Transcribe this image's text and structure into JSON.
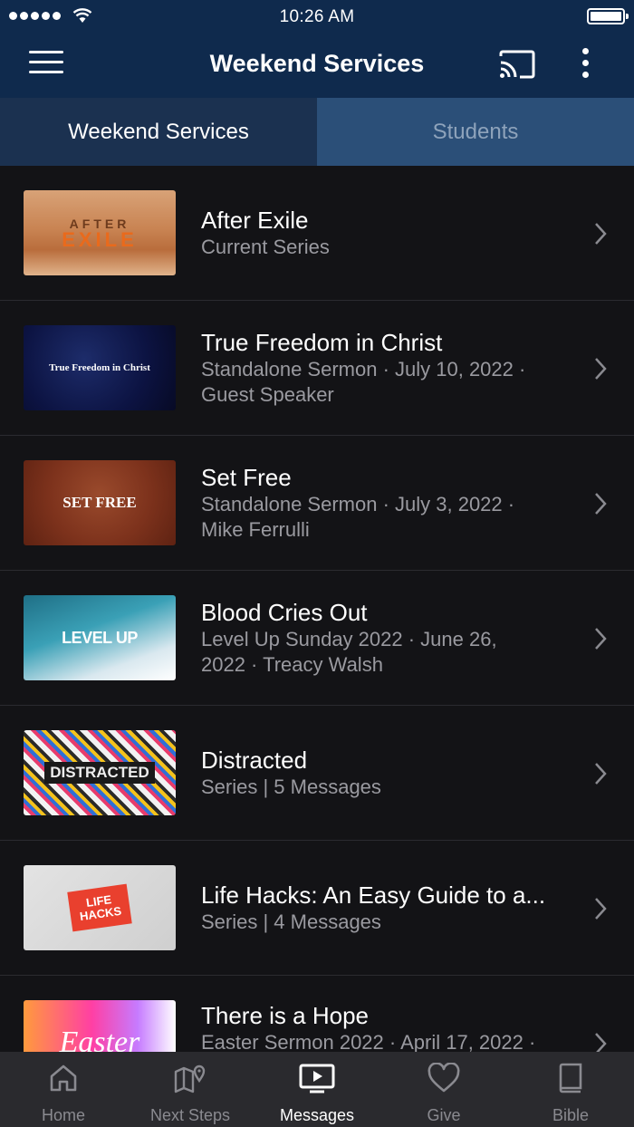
{
  "status_bar": {
    "time": "10:26 AM"
  },
  "header": {
    "title": "Weekend Services"
  },
  "tabs": [
    {
      "label": "Weekend Services",
      "active": true
    },
    {
      "label": "Students",
      "active": false
    }
  ],
  "items": [
    {
      "title": "After Exile",
      "line1": "Current Series",
      "line2": "",
      "thumb_text": [
        "AFTER",
        "EXILE"
      ]
    },
    {
      "title": "True Freedom in Christ",
      "line1": "Standalone Sermon · July 10, 2022 ·",
      "line2": "Guest Speaker",
      "thumb_text": "True Freedom in Christ"
    },
    {
      "title": "Set Free",
      "line1": "Standalone Sermon · July 3, 2022 ·",
      "line2": "Mike Ferrulli",
      "thumb_text": "SET FREE"
    },
    {
      "title": "Blood Cries Out",
      "line1": "Level Up Sunday 2022 · June 26,",
      "line2": "2022 · Treacy Walsh",
      "thumb_text": "LEVEL UP"
    },
    {
      "title": "Distracted",
      "line1": "Series | 5 Messages",
      "line2": "",
      "thumb_text": "DISTRACTED"
    },
    {
      "title": "Life Hacks: An Easy Guide to a...",
      "line1": "Series | 4 Messages",
      "line2": "",
      "thumb_text": [
        "LIFE",
        "HACKS"
      ]
    },
    {
      "title": "There is a Hope",
      "line1": "Easter Sermon 2022 · April 17, 2022 ·",
      "line2": "",
      "thumb_text": "Easter"
    }
  ],
  "bottom_nav": [
    {
      "label": "Home",
      "icon": "home-icon",
      "active": false
    },
    {
      "label": "Next Steps",
      "icon": "map-pin-icon",
      "active": false
    },
    {
      "label": "Messages",
      "icon": "tv-play-icon",
      "active": true
    },
    {
      "label": "Give",
      "icon": "heart-icon",
      "active": false
    },
    {
      "label": "Bible",
      "icon": "book-icon",
      "active": false
    }
  ],
  "colors": {
    "header_bg": "#0f2a4d",
    "tab_active_bg": "#1b3150",
    "tab_inactive_bg": "#2b4f78",
    "list_bg": "#131316",
    "bottom_bar_bg": "#2a2a2e"
  }
}
